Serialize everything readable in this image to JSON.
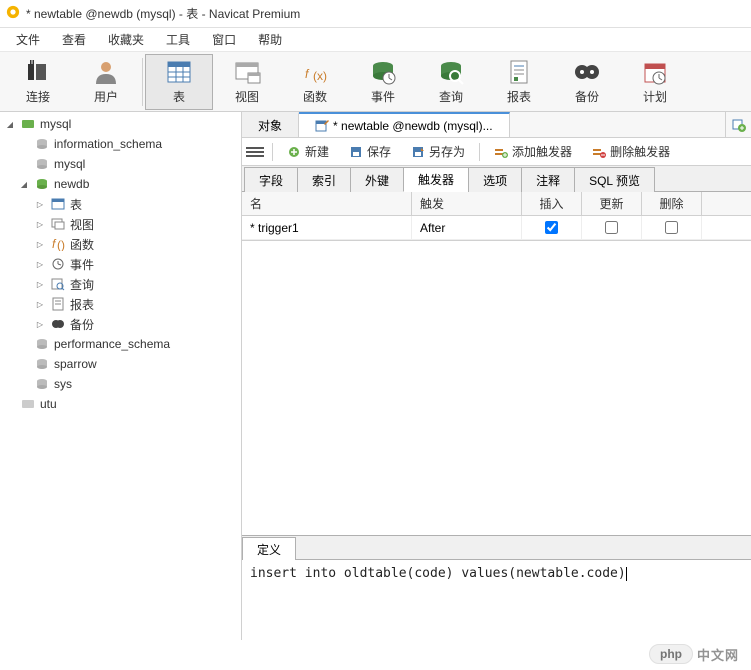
{
  "window": {
    "title": "* newtable @newdb (mysql) - 表 - Navicat Premium"
  },
  "menus": [
    "文件",
    "查看",
    "收藏夹",
    "工具",
    "窗口",
    "帮助"
  ],
  "toolbar": [
    {
      "label": "连接",
      "icon": "plug-icon"
    },
    {
      "label": "用户",
      "icon": "user-icon"
    },
    {
      "label": "表",
      "icon": "table-icon",
      "active": true
    },
    {
      "label": "视图",
      "icon": "view-icon"
    },
    {
      "label": "函数",
      "icon": "function-icon"
    },
    {
      "label": "事件",
      "icon": "event-icon"
    },
    {
      "label": "查询",
      "icon": "query-icon"
    },
    {
      "label": "报表",
      "icon": "report-icon"
    },
    {
      "label": "备份",
      "icon": "backup-icon"
    },
    {
      "label": "计划",
      "icon": "schedule-icon"
    }
  ],
  "tree": {
    "root": {
      "label": "mysql",
      "icon": "server-icon"
    },
    "databases": [
      {
        "label": "information_schema",
        "icon": "db-icon"
      },
      {
        "label": "mysql",
        "icon": "db-icon"
      },
      {
        "label": "newdb",
        "icon": "db-icon",
        "expanded": true,
        "children": [
          {
            "label": "表",
            "icon": "tables-icon"
          },
          {
            "label": "视图",
            "icon": "views-icon"
          },
          {
            "label": "函数",
            "icon": "functions-icon"
          },
          {
            "label": "事件",
            "icon": "events-icon"
          },
          {
            "label": "查询",
            "icon": "queries-icon"
          },
          {
            "label": "报表",
            "icon": "reports-icon"
          },
          {
            "label": "备份",
            "icon": "backups-icon"
          }
        ]
      },
      {
        "label": "performance_schema",
        "icon": "db-icon"
      },
      {
        "label": "sparrow",
        "icon": "db-icon"
      },
      {
        "label": "sys",
        "icon": "db-icon"
      }
    ],
    "other": {
      "label": "utu",
      "icon": "server-grey-icon"
    }
  },
  "tabs": [
    {
      "label": "对象",
      "active": false
    },
    {
      "label": "* newtable @newdb (mysql)...",
      "active": true
    }
  ],
  "actions": {
    "new": "新建",
    "save": "保存",
    "saveas": "另存为",
    "add_trigger": "添加触发器",
    "del_trigger": "删除触发器"
  },
  "sub_tabs": [
    "字段",
    "索引",
    "外键",
    "触发器",
    "选项",
    "注释",
    "SQL 预览"
  ],
  "sub_tab_active": 3,
  "grid": {
    "headers": {
      "name": "名",
      "fire": "触发",
      "insert": "插入",
      "update": "更新",
      "delete": "删除"
    },
    "rows": [
      {
        "marker": "*",
        "name": "trigger1",
        "fire": "After",
        "insert": true,
        "update": false,
        "delete": false
      }
    ]
  },
  "definition": {
    "tab": "定义",
    "sql": "insert into oldtable(code) values(newtable.code)"
  },
  "watermark": {
    "badge": "php",
    "text": "中文网"
  }
}
